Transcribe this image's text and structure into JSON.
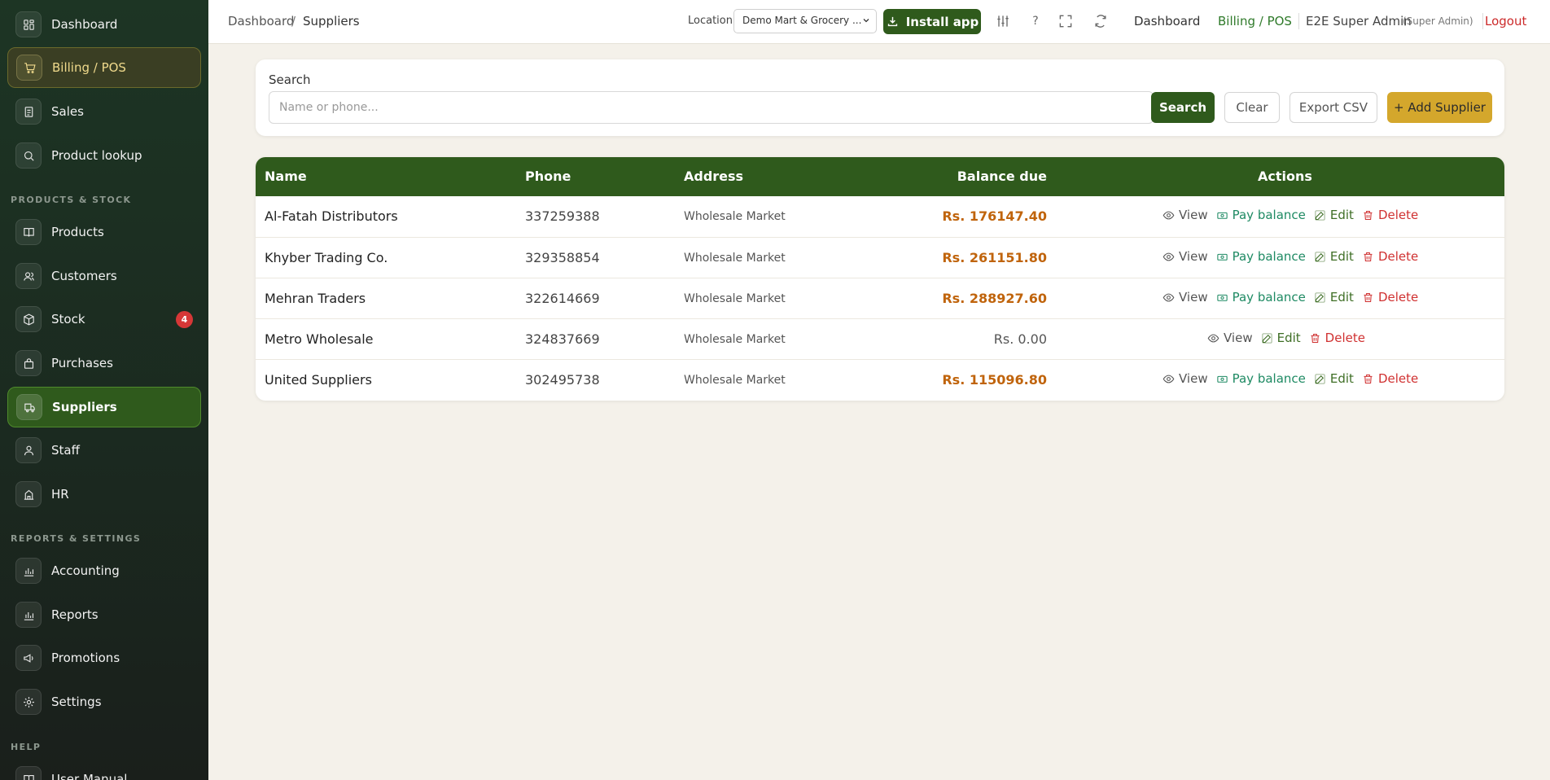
{
  "sidebar": {
    "items": [
      {
        "label": "Dashboard",
        "icon": "dashboard-icon"
      },
      {
        "label": "Billing / POS",
        "icon": "cart-icon"
      },
      {
        "label": "Sales",
        "icon": "receipt-icon"
      },
      {
        "label": "Product lookup",
        "icon": "search-icon"
      },
      {
        "label": "Products",
        "icon": "book-icon"
      },
      {
        "label": "Customers",
        "icon": "users-icon"
      },
      {
        "label": "Stock",
        "icon": "box-icon",
        "badge": "4"
      },
      {
        "label": "Purchases",
        "icon": "bag-icon"
      },
      {
        "label": "Suppliers",
        "icon": "truck-icon"
      },
      {
        "label": "Staff",
        "icon": "person-icon"
      },
      {
        "label": "HR",
        "icon": "building-icon"
      },
      {
        "label": "Accounting",
        "icon": "bar-chart-icon"
      },
      {
        "label": "Reports",
        "icon": "bar-chart-icon"
      },
      {
        "label": "Promotions",
        "icon": "megaphone-icon"
      },
      {
        "label": "Settings",
        "icon": "gear-icon"
      },
      {
        "label": "User Manual",
        "icon": "manual-icon"
      }
    ],
    "sections": {
      "products_stock": "PRODUCTS & STOCK",
      "reports_settings": "REPORTS & SETTINGS",
      "help": "HELP"
    }
  },
  "topbar": {
    "breadcrumb_root": "Dashboard",
    "breadcrumb_sep": "/",
    "breadcrumb_current": "Suppliers",
    "location_label": "Location",
    "location_value": "Demo Mart & Grocery ...",
    "install_label": "Install app",
    "help_glyph": "?",
    "nav_dashboard": "Dashboard",
    "nav_billing": "Billing / POS",
    "user_name": "E2E Super Admin",
    "user_role": "(Super Admin)",
    "logout": "Logout"
  },
  "search": {
    "label": "Search",
    "placeholder": "Name or phone...",
    "search_btn": "Search",
    "clear_btn": "Clear",
    "export_btn": "Export CSV",
    "add_btn": "+ Add Supplier"
  },
  "table": {
    "headers": {
      "name": "Name",
      "phone": "Phone",
      "address": "Address",
      "balance": "Balance due",
      "actions": "Actions"
    },
    "action_labels": {
      "view": "View",
      "pay": "Pay balance",
      "edit": "Edit",
      "delete": "Delete"
    },
    "rows": [
      {
        "name": "Al-Fatah Distributors",
        "phone": "337259388",
        "address": "Wholesale Market",
        "balance": "Rs. 176147.40"
      },
      {
        "name": "Khyber Trading Co.",
        "phone": "329358854",
        "address": "Wholesale Market",
        "balance": "Rs. 261151.80"
      },
      {
        "name": "Mehran Traders",
        "phone": "322614669",
        "address": "Wholesale Market",
        "balance": "Rs. 288927.60"
      },
      {
        "name": "Metro Wholesale",
        "phone": "324837669",
        "address": "Wholesale Market",
        "balance": "Rs. 0.00"
      },
      {
        "name": "United Suppliers",
        "phone": "302495738",
        "address": "Wholesale Market",
        "balance": "Rs. 115096.80"
      }
    ]
  },
  "colors": {
    "primary": "#2f5a1c",
    "accent": "#d4a72c",
    "balance": "#c0640c",
    "danger": "#d03131",
    "pay": "#1e8a63"
  }
}
